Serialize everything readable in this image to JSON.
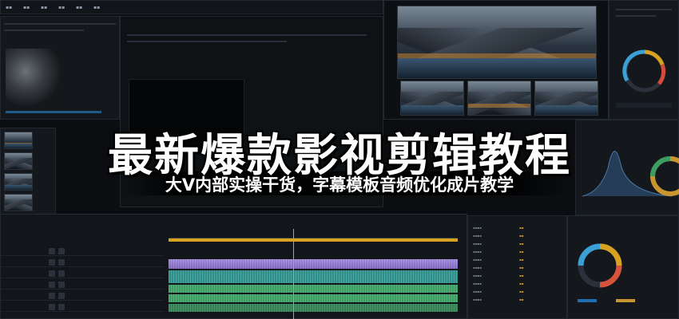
{
  "headline": "最新爆款影视剪辑教程",
  "subtitle": "大V内部实操干货，字幕模板音频优化成片教学",
  "colors": {
    "accent_gold": "#d6a21f",
    "clip_purple": "#9d86d6",
    "clip_teal": "#2d8f8a",
    "clip_green": "#3a9e62",
    "playhead_blue": "#5fb4ff"
  },
  "icons": [
    "play-icon",
    "lock-icon",
    "eye-icon",
    "mic-icon",
    "circle-scope-icon"
  ]
}
